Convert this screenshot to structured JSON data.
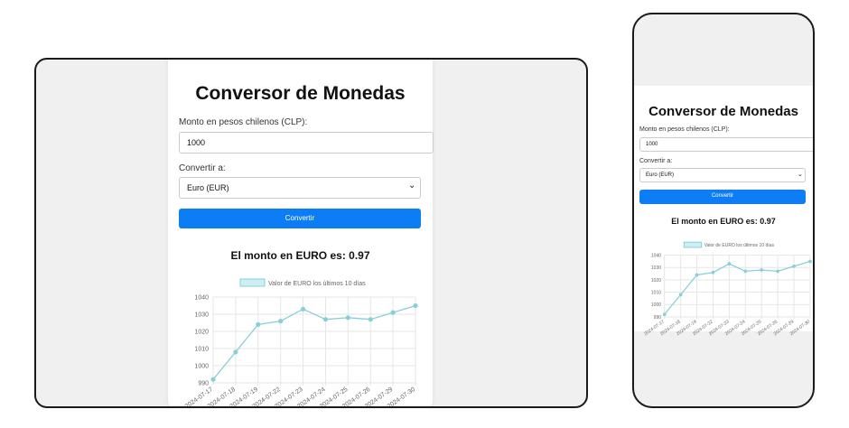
{
  "app": {
    "title": "Conversor de Monedas",
    "amount_label": "Monto en pesos chilenos (CLP):",
    "amount_value": "1000",
    "convert_to_label": "Convertir a:",
    "selected_currency": "Euro (EUR)",
    "convert_button": "Convertir",
    "result_text": "El monto en EURO es: 0.97"
  },
  "colors": {
    "accent": "#0d7df5",
    "series_line": "#89cfd8",
    "series_fill": "#cdeef2"
  },
  "chart_data": {
    "type": "line",
    "x": [
      "2024-07-17",
      "2024-07-18",
      "2024-07-19",
      "2024-07-22",
      "2024-07-23",
      "2024-07-24",
      "2024-07-25",
      "2024-07-26",
      "2024-07-29",
      "2024-07-30"
    ],
    "series": [
      {
        "name": "Valor de EURO los últimos 10 días",
        "values": [
          992,
          1008,
          1024,
          1026,
          1033,
          1027,
          1028,
          1027,
          1031,
          1035
        ]
      }
    ],
    "ylim": [
      990,
      1040
    ],
    "yticks": [
      990,
      1000,
      1010,
      1020,
      1030,
      1040
    ],
    "grid": true,
    "legend": "top"
  }
}
